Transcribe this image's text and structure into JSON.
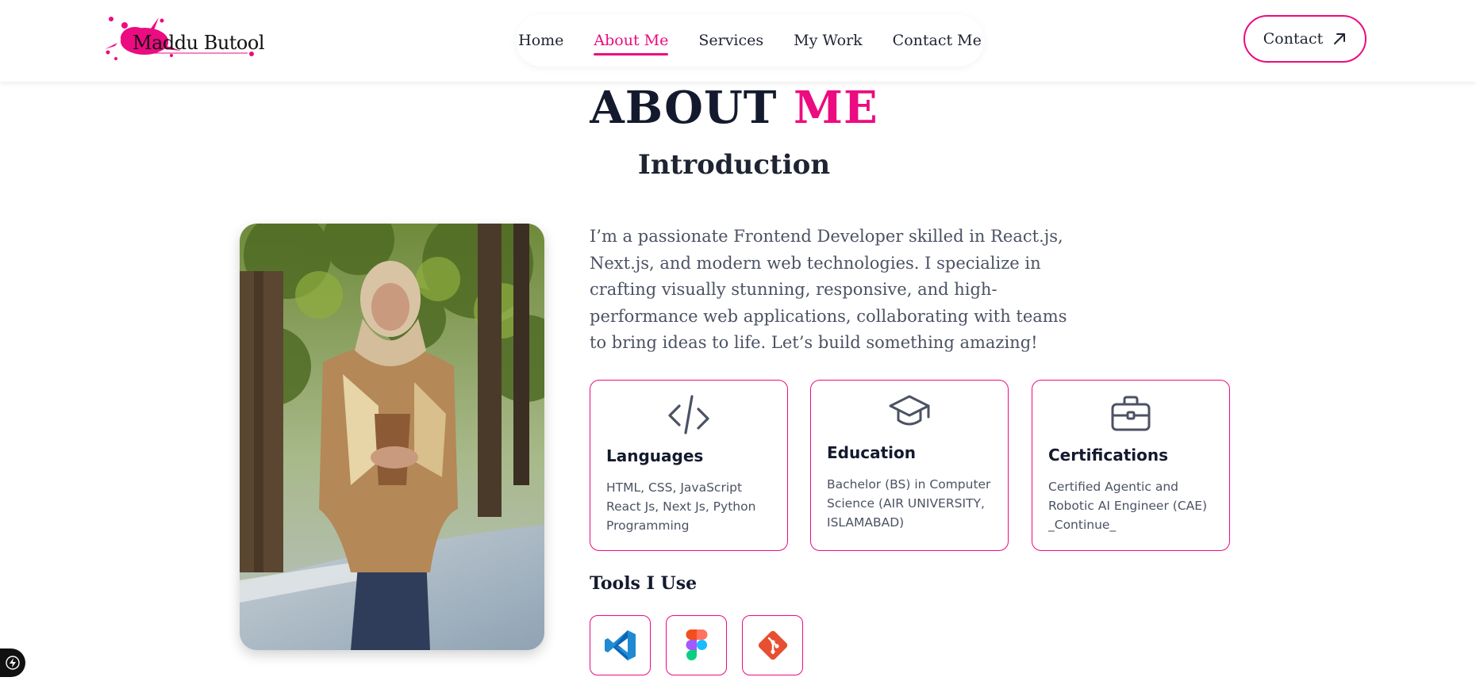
{
  "header": {
    "logo_text": "Maddu Butool",
    "nav": [
      {
        "label": "Home",
        "active": false
      },
      {
        "label": "About Me",
        "active": true
      },
      {
        "label": "Services",
        "active": false
      },
      {
        "label": "My Work",
        "active": false
      },
      {
        "label": "Contact Me",
        "active": false
      }
    ],
    "contact_label": "Contact",
    "contact_icon": "arrow-up-right-icon"
  },
  "about": {
    "title_main": "ABOUT",
    "title_accent": "ME",
    "subtitle": "Introduction",
    "paragraph": "I’m a passionate Frontend Developer skilled in React.js, Next.js, and modern web technologies. I specialize in crafting visually stunning, responsive, and high-performance web applications, collaborating with teams to bring ideas to life. Let’s build something amazing!"
  },
  "cards": [
    {
      "icon": "code-icon",
      "title": "Languages",
      "desc": "HTML, CSS, JavaScript React Js, Next Js, Python Programming"
    },
    {
      "icon": "graduation-cap-icon",
      "title": "Education",
      "desc": "Bachelor (BS) in Computer Science (AIR UNIVERSITY, ISLAMABAD)"
    },
    {
      "icon": "briefcase-icon",
      "title": "Certifications",
      "desc": "Certified Agentic and Robotic AI Engineer (CAE) _Continue_"
    }
  ],
  "tools": {
    "title": "Tools I Use",
    "items": [
      "vscode-icon",
      "figma-icon",
      "git-icon"
    ]
  },
  "colors": {
    "accent": "#ec0b80",
    "heading": "#141a2e",
    "body_text": "#4b5263"
  }
}
